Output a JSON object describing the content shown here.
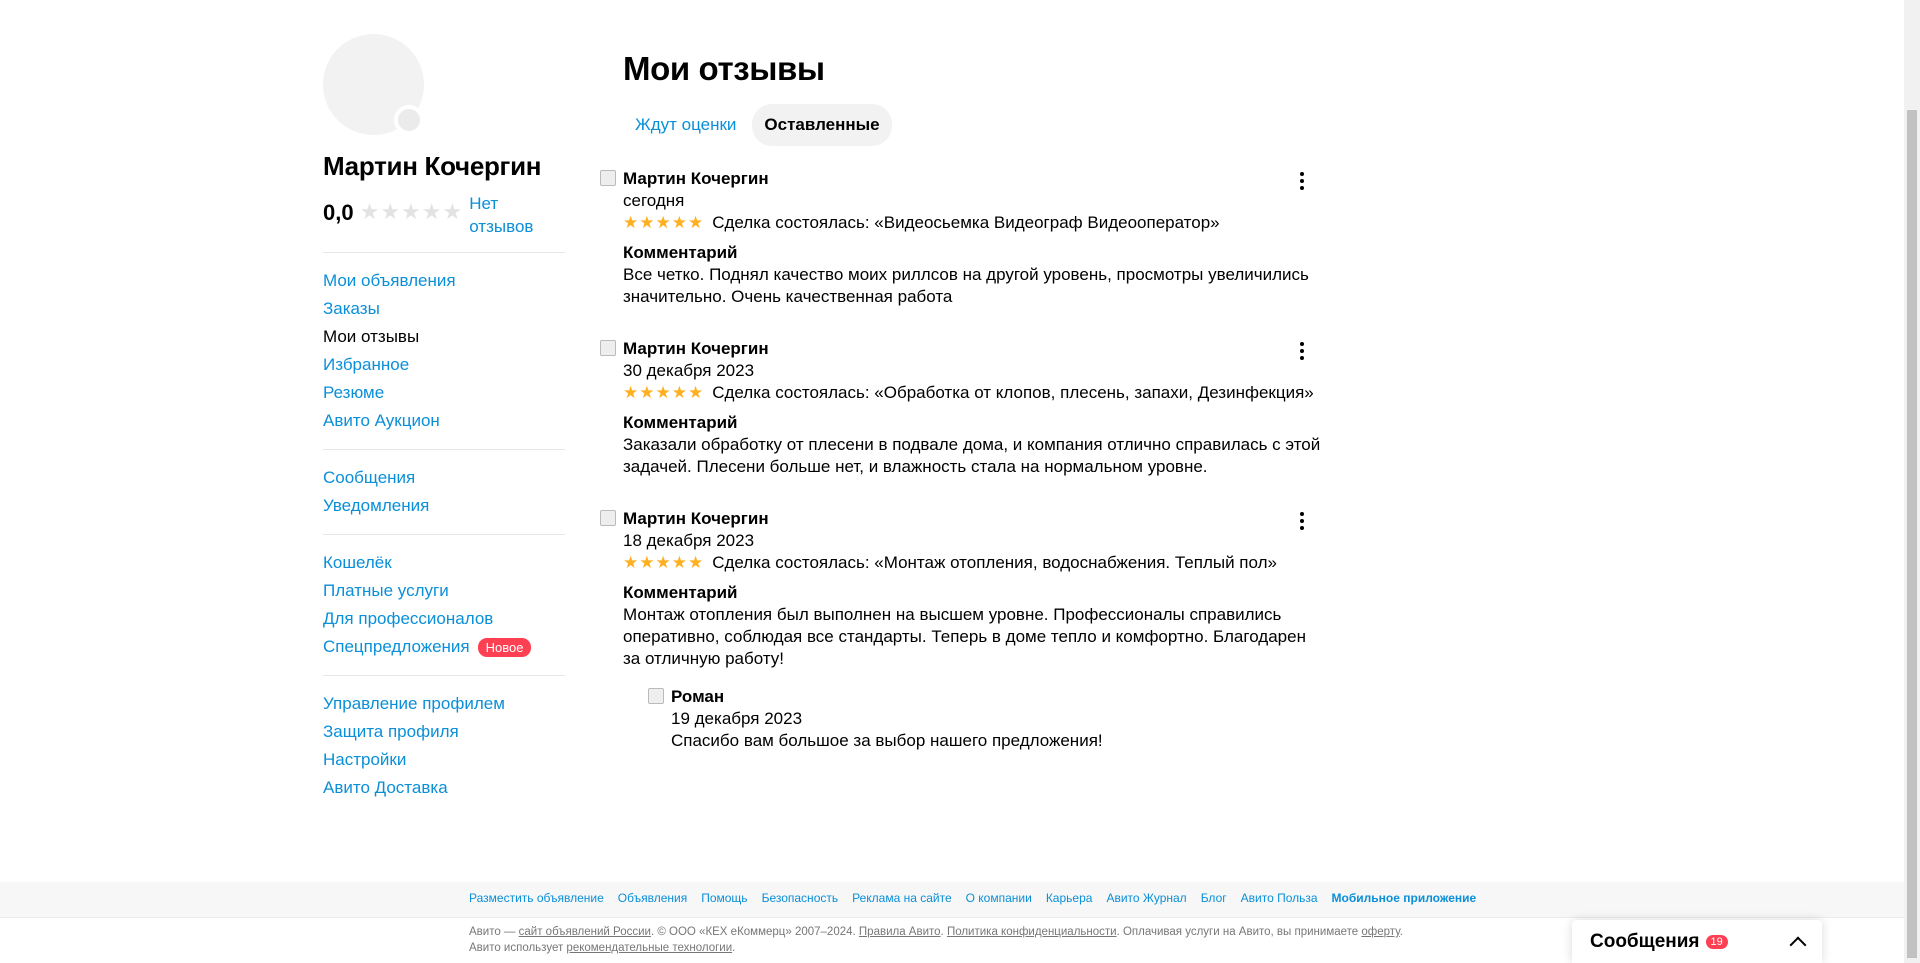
{
  "profile": {
    "name": "Мартин Кочергин",
    "rating_value": "0,0",
    "rating_stars": "★★★★★",
    "no_reviews": "Нет отзывов"
  },
  "sidebar": {
    "group1": [
      {
        "label": "Мои объявления",
        "active": false
      },
      {
        "label": "Заказы",
        "active": false
      },
      {
        "label": "Мои отзывы",
        "active": true
      },
      {
        "label": "Избранное",
        "active": false
      },
      {
        "label": "Резюме",
        "active": false
      },
      {
        "label": "Авито Аукцион",
        "active": false
      }
    ],
    "group2": [
      {
        "label": "Сообщения"
      },
      {
        "label": "Уведомления"
      }
    ],
    "group3": [
      {
        "label": "Кошелёк"
      },
      {
        "label": "Платные услуги"
      },
      {
        "label": "Для профессионалов"
      },
      {
        "label": "Спецпредложения",
        "badge": "Новое"
      }
    ],
    "group4": [
      {
        "label": "Управление профилем"
      },
      {
        "label": "Защита профиля"
      },
      {
        "label": "Настройки"
      },
      {
        "label": "Авито Доставка"
      }
    ]
  },
  "main": {
    "title": "Мои отзывы",
    "tabs": [
      {
        "label": "Ждут оценки",
        "active": false
      },
      {
        "label": "Оставленные",
        "active": true
      }
    ],
    "reviews": [
      {
        "author": "Мартин Кочергин",
        "date": "сегодня",
        "stars": "★★★★★",
        "deal": "Сделка состоялась: «Видеосьемка Видеограф Видеооператор»",
        "comment_title": "Комментарий",
        "comment": "Все четко. Поднял качество моих риллсов на другой уровень, просмотры увеличились значительно. Очень качественная работа"
      },
      {
        "author": "Мартин Кочергин",
        "date": "30 декабря 2023",
        "stars": "★★★★★",
        "deal": "Сделка состоялась: «Обработка от клопов, плесень, запахи, Дезинфекция»",
        "comment_title": "Комментарий",
        "comment": "Заказали обработку от плесени в подвале дома, и компания отлично справилась с этой задачей. Плесени больше нет, и влажность стала на нормальном уровне."
      },
      {
        "author": "Мартин Кочергин",
        "date": "18 декабря 2023",
        "stars": "★★★★★",
        "deal": "Сделка состоялась: «Монтаж отопления, водоснабжения. Теплый пол»",
        "comment_title": "Комментарий",
        "comment": "Монтаж отопления был выполнен на высшем уровне. Профессионалы справились оперативно, соблюдая все стандарты. Теперь в доме тепло и комфортно. Благодарен за отличную работу!",
        "reply": {
          "author": "Роман",
          "date": "19 декабря 2023",
          "text": "Спасибо вам большое за выбор нашего предложения!"
        }
      }
    ]
  },
  "footer": {
    "links": [
      "Разместить объявление",
      "Объявления",
      "Помощь",
      "Безопасность",
      "Реклама на сайте",
      "О компании",
      "Карьера",
      "Авито Журнал",
      "Блог",
      "Авито Польза",
      "Мобильное приложение"
    ],
    "legal": {
      "p1": "Авито — ",
      "l1": "сайт объявлений России",
      "p2": ". © ООО «КЕХ еКоммерц» 2007–2024. ",
      "l2": "Правила Авито",
      "p3": ". ",
      "l3": "Политика конфиденциальности",
      "p4": ". Оплачивая услуги на Авито, вы принимаете ",
      "l4": "оферту",
      "p5": ". Авито использует ",
      "l5": "рекомендательные технологии",
      "p6": "."
    }
  },
  "messenger": {
    "title": "Сообщения",
    "count": "19"
  }
}
